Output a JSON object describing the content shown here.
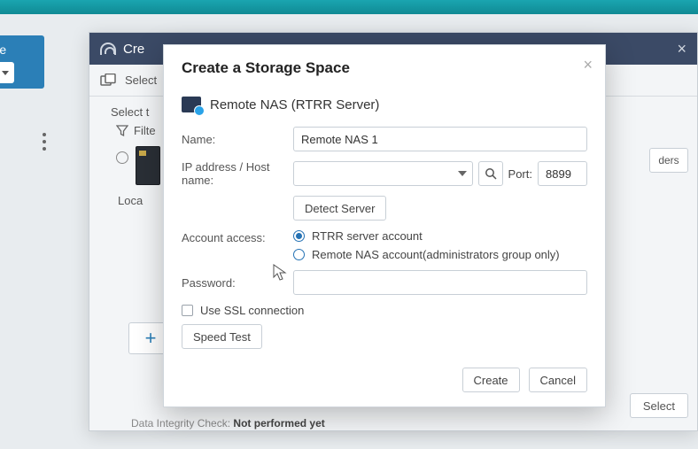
{
  "topbar": {},
  "sidebar": {
    "label": "store"
  },
  "window1": {
    "title_prefix": "Cre",
    "toolbar": {
      "select_label": "Select "
    },
    "content": {
      "select_label": "Select t",
      "filter_label": "Filte",
      "local_label": "Loca",
      "right_btn_fragment": "ders",
      "select_btn": "Select"
    },
    "footer": {
      "integrity_label": "Data Integrity Check:",
      "integrity_value": "Not performed yet"
    }
  },
  "modal": {
    "title": "Create a Storage Space",
    "server_type": "Remote NAS (RTRR Server)",
    "fields": {
      "name_label": "Name:",
      "name_value": "Remote NAS 1",
      "ip_label": "IP address / Host name:",
      "ip_value": "",
      "port_label": "Port:",
      "port_value": "8899",
      "detect_btn": "Detect Server",
      "account_label": "Account access:",
      "opt_rtrr": "RTRR server account",
      "opt_remote": "Remote NAS account(administrators group only)",
      "password_label": "Password:",
      "password_value": "",
      "ssl_label": "Use SSL connection",
      "speed_btn": "Speed Test"
    },
    "buttons": {
      "create": "Create",
      "cancel": "Cancel"
    }
  }
}
